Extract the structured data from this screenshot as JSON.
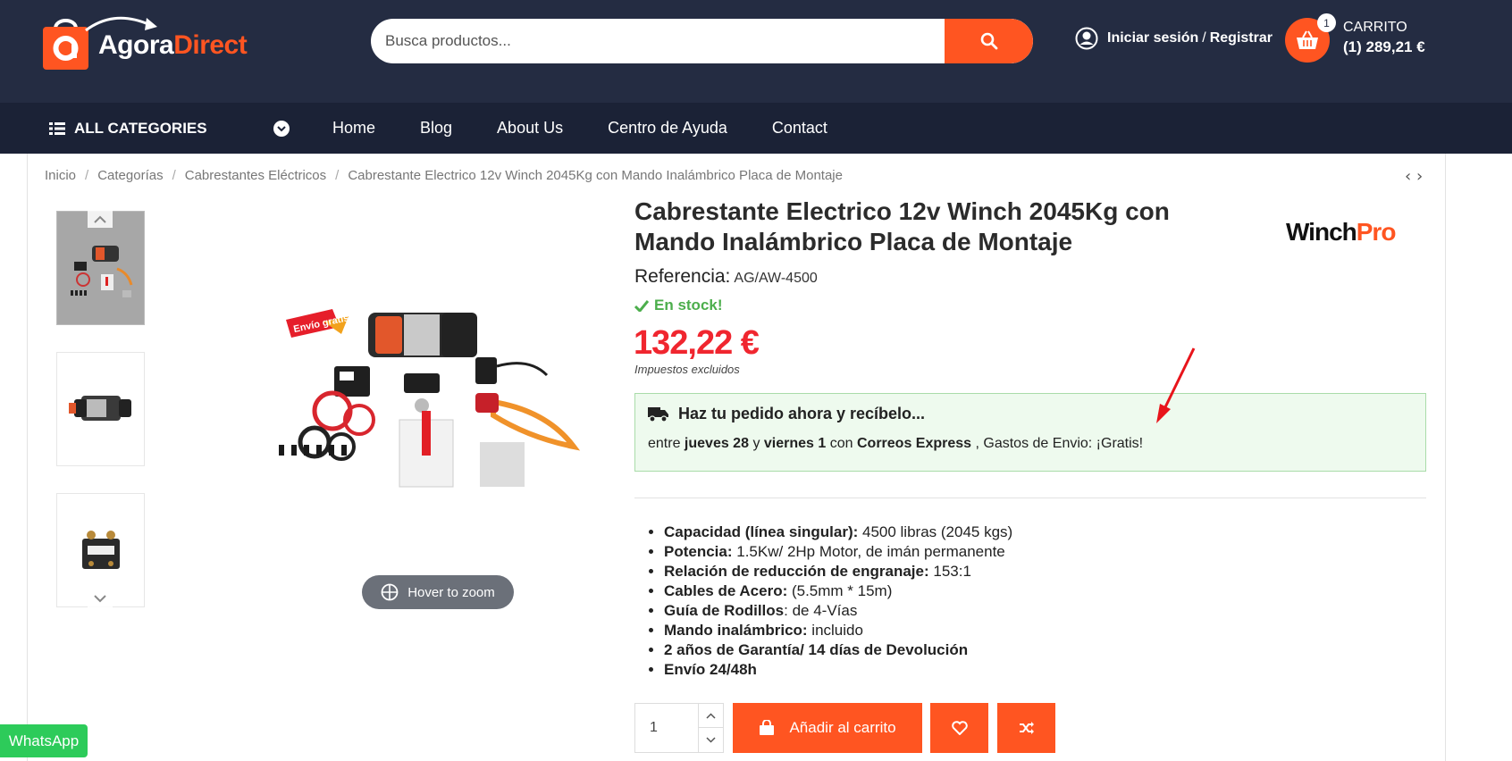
{
  "header": {
    "logo": {
      "text_a": "Agora",
      "text_b": "Direct"
    },
    "search": {
      "placeholder": "Busca productos..."
    },
    "account": {
      "login": "Iniciar sesión",
      "separator": "/",
      "register": "Registrar"
    },
    "cart": {
      "count": "1",
      "label": "CARRITO",
      "summary": "(1) 289,21 €"
    }
  },
  "nav": {
    "all_categories": "ALL CATEGORIES",
    "links": [
      "Home",
      "Blog",
      "About Us",
      "Centro de Ayuda",
      "Contact"
    ]
  },
  "breadcrumb": [
    "Inicio",
    "Categorías",
    "Cabrestantes Eléctricos",
    "Cabrestante Electrico 12v Winch 2045Kg con Mando Inalámbrico Placa de Montaje"
  ],
  "product": {
    "title": "Cabrestante Electrico 12v Winch 2045Kg con Mando Inalámbrico Placa de Montaje",
    "brand": {
      "part1": "Winch",
      "part2": "Pro"
    },
    "reference_label": "Referencia:",
    "reference_value": "AG/AW-4500",
    "stock": "En stock!",
    "price": "132,22 €",
    "tax_note": "Impuestos excluidos",
    "zoom_label": "Hover to zoom",
    "badge_text": "Envío gratis"
  },
  "delivery": {
    "heading": "Haz tu pedido ahora y recíbelo...",
    "prefix": "entre",
    "day1": "jueves 28",
    "conj": "y",
    "day2": "viernes 1",
    "with": "con",
    "carrier": "Correos Express",
    "suffix": ", Gastos de Envio: ¡Gratis!"
  },
  "specs": [
    {
      "label": "Capacidad (línea singular):",
      "value": " 4500 libras (2045 kgs)"
    },
    {
      "label": "Potencia:",
      "value": " 1.5Kw/ 2Hp Motor, de imán permanente"
    },
    {
      "label": "Relación de reducción de engranaje:",
      "value": " 153:1"
    },
    {
      "label": "Cables de Acero:",
      "value": " (5.5mm * 15m)"
    },
    {
      "label": "Guía de Rodillos",
      "value": ": de 4-Vías"
    },
    {
      "label": "Mando inalámbrico:",
      "value": " incluido"
    },
    {
      "label": "2 años de Garantía/ 14 días de Devolución",
      "value": ""
    },
    {
      "label": "Envío 24/48h",
      "value": ""
    }
  ],
  "purchase": {
    "quantity": "1",
    "add_to_cart": "Añadir al carrito"
  },
  "whatsapp": "WhatsApp",
  "colors": {
    "accent": "#ff5521",
    "header_bg": "#242c42",
    "nav_bg": "#1b2236",
    "price": "#f0262f",
    "stock": "#4cae4c",
    "whatsapp": "#2dcb5a"
  },
  "icons": [
    "search-icon",
    "user-icon",
    "cart-icon",
    "list-icon",
    "chevron-down-icon",
    "truck-icon",
    "check-icon",
    "shopping-bag-icon",
    "heart-icon",
    "shuffle-icon",
    "crosshair-icon"
  ]
}
